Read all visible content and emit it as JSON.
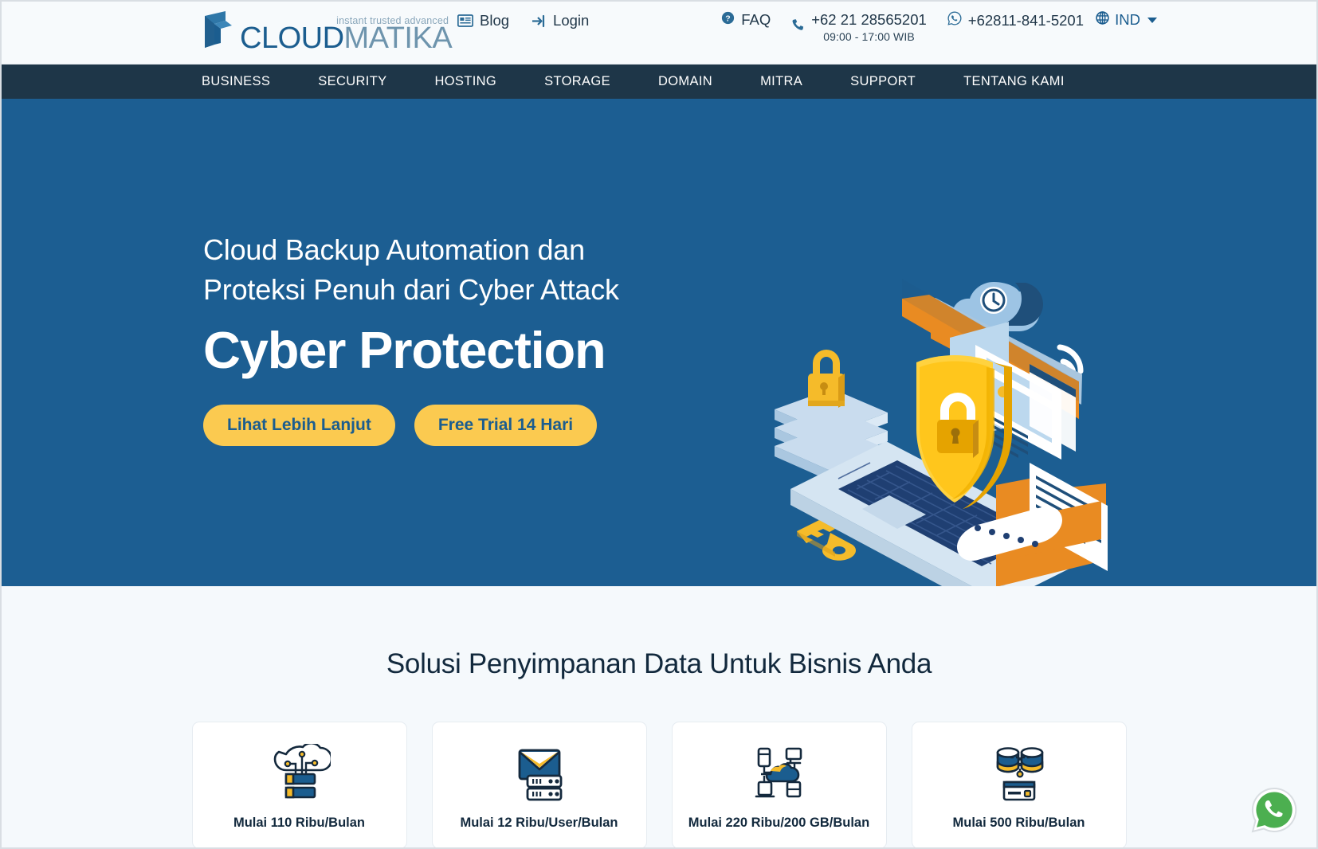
{
  "header": {
    "logo": {
      "tagline": "instant trusted advanced",
      "word_primary": "CLOUD",
      "word_secondary": "MATIKA",
      "mark_icon": "cloudmatika-logo-icon"
    },
    "links": [
      {
        "label": "Blog",
        "icon": "blog-icon"
      },
      {
        "label": "Login",
        "icon": "login-icon"
      }
    ],
    "faq": {
      "label": "FAQ",
      "icon": "question-circle-icon"
    },
    "phone": {
      "number": "+62 21 28565201",
      "hours": "09:00 - 17:00 WIB",
      "icon": "phone-icon"
    },
    "whatsapp": {
      "number": "+62811-841-5201",
      "icon": "whatsapp-icon"
    },
    "language": {
      "label": "IND",
      "icon": "globe-icon"
    }
  },
  "nav": {
    "items": [
      "BUSINESS",
      "SECURITY",
      "HOSTING",
      "STORAGE",
      "DOMAIN",
      "MITRA",
      "SUPPORT",
      "TENTANG KAMI"
    ]
  },
  "hero": {
    "subtitle_line1": "Cloud Backup Automation dan",
    "subtitle_line2": "Proteksi Penuh dari Cyber Attack",
    "title": "Cyber Protection",
    "buttons": [
      "Lihat Lebih Lanjut",
      "Free Trial 14 Hari"
    ],
    "illustration": "cyber-protection-illustration"
  },
  "solutions": {
    "title": "Solusi Penyimpanan Data Untuk Bisnis Anda",
    "cards": [
      {
        "label": "Mulai 110 Ribu/Bulan",
        "icon": "cloud-server-icon"
      },
      {
        "label": "Mulai 12 Ribu/User/Bulan",
        "icon": "email-server-icon"
      },
      {
        "label": "Mulai 220 Ribu/200 GB/Bulan",
        "icon": "cloud-network-icon"
      },
      {
        "label": "Mulai 500 Ribu/Bulan",
        "icon": "database-backup-icon"
      }
    ]
  },
  "floating": {
    "whatsapp": "whatsapp-float-icon"
  },
  "colors": {
    "hero_background": "#1c5e92",
    "nav_background": "#1e3648",
    "accent_yellow": "#fbca50",
    "brand_blue": "#1b5d8f",
    "section_background": "#f5f9fc",
    "whatsapp_green": "#4caf50"
  }
}
